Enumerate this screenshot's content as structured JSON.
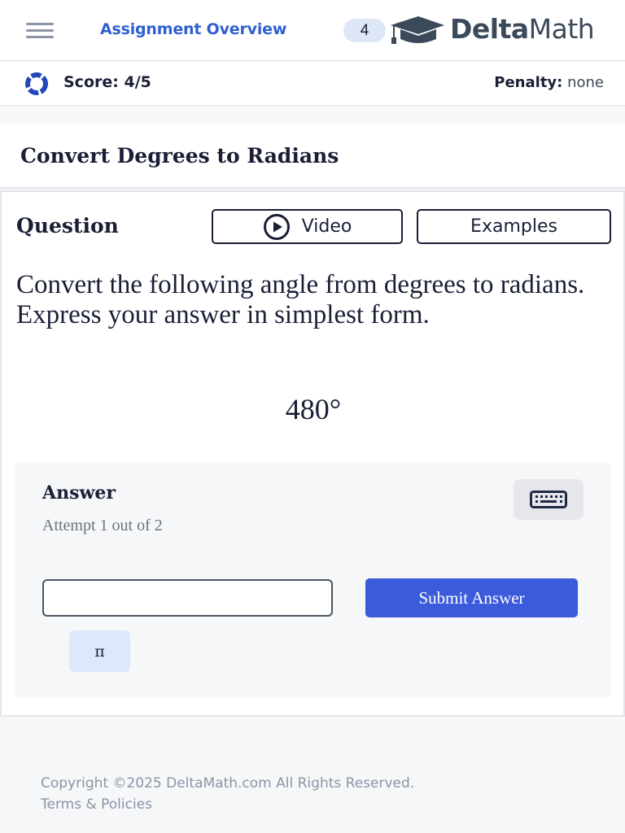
{
  "header": {
    "menu_icon": "hamburger-menu-icon",
    "assignment_link": "Assignment Overview",
    "badge_count": "4",
    "logo_icon": "graduation-cap-icon",
    "logo_text_bold": "Delta",
    "logo_text_regular": "Math"
  },
  "scorebar": {
    "progress_icon": "score-ring-icon",
    "score_label": "Score: 4/5",
    "penalty_label": "Penalty:",
    "penalty_value": "none"
  },
  "problem": {
    "title": "Convert Degrees to Radians"
  },
  "question": {
    "label": "Question",
    "video_button": "Video",
    "video_icon": "play-circle-icon",
    "examples_button": "Examples",
    "prompt": "Convert the following angle from degrees to radians. Express your answer in simplest form.",
    "angle": "480°"
  },
  "answer": {
    "label": "Answer",
    "attempt_text": "Attempt 1 out of 2",
    "keyboard_icon": "keyboard-icon",
    "input_value": "",
    "submit_button": "Submit Answer",
    "pi_button": "π"
  },
  "footer": {
    "copyright": "Copyright ©2025 DeltaMath.com All Rights Reserved.",
    "terms_link": "Terms & Policies"
  },
  "colors": {
    "accent_blue": "#3b5bdb",
    "link_blue": "#2f5fd0",
    "text_dark": "#1a1f36",
    "muted_gray": "#8a94a6"
  }
}
